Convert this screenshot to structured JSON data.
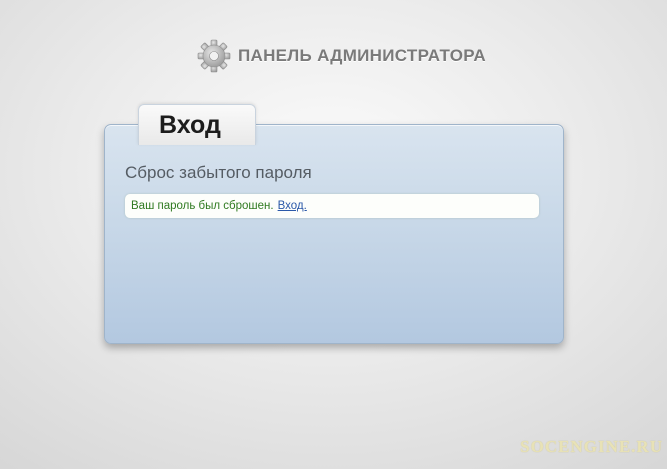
{
  "header": {
    "title": "ПАНЕЛЬ АДМИНИСТРАТОРА",
    "icon": "gear-icon"
  },
  "login_panel": {
    "tab_label": "Вход",
    "title": "Сброс забытого пароля",
    "message": {
      "text": "Ваш пароль был сброшен.",
      "link_label": "Вход."
    }
  },
  "watermark": "SOCENGINE.RU",
  "colors": {
    "panel_top": "#d9e4ef",
    "panel_bottom": "#b3c8e0",
    "message_text": "#2f7a20",
    "link": "#2a58a8",
    "header_text": "#7a7a7a"
  }
}
